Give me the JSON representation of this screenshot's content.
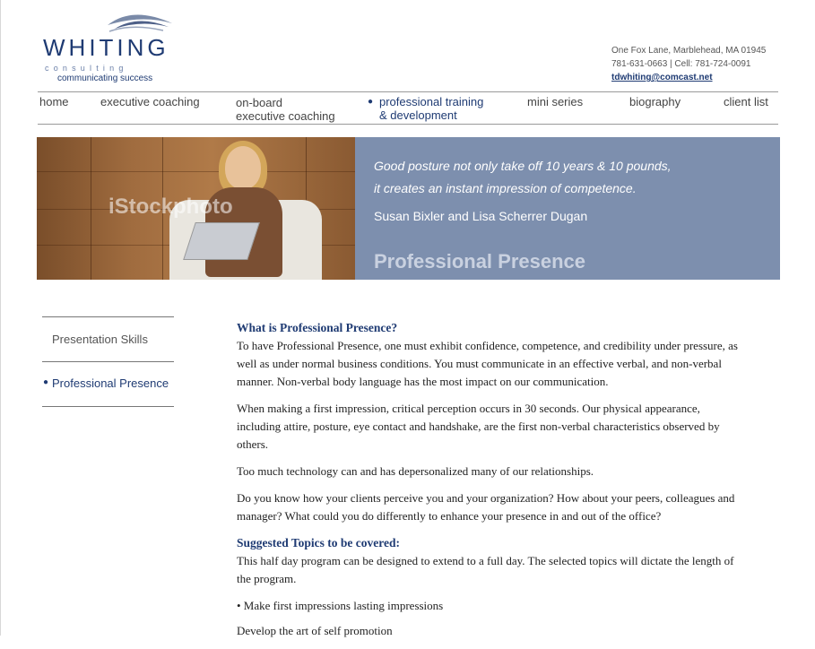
{
  "header": {
    "logo": {
      "brand": "WHITING",
      "sub1": "consulting",
      "tagline": "communicating success"
    },
    "contact": {
      "address": "One Fox Lane, Marblehead, MA 01945",
      "phones": "781-631-0663 | Cell: 781-724-0091",
      "email": "tdwhiting@comcast.net"
    }
  },
  "nav": {
    "home": "home",
    "executive_coaching": "executive coaching",
    "onboard_line1": "on-board",
    "onboard_line2": "executive coaching",
    "training_line1": "professional training",
    "training_line2": "& development",
    "mini_series": "mini series",
    "biography": "biography",
    "client_list": "client list"
  },
  "banner": {
    "watermark": "iStockphoto",
    "quote_line1": "Good posture not only take off 10 years & 10 pounds,",
    "quote_line2": "it creates an instant impression of competence.",
    "authors": "Susan Bixler and Lisa Scherrer Dugan",
    "title": "Professional Presence"
  },
  "sidebar": {
    "items": [
      {
        "label": "Presentation Skills"
      },
      {
        "label": "Professional Presence"
      }
    ]
  },
  "content": {
    "heading1": "What is Professional Presence?",
    "p1": "To have Professional Presence, one must exhibit confidence, competence, and credibility under pressure, as well as under normal business conditions. You must communicate in an effective verbal, and non-verbal manner. Non-verbal body language has the most impact on our communication.",
    "p2": "When making a first impression, critical perception occurs in 30 seconds. Our physical appearance, including attire, posture, eye contact and handshake, are the first non-verbal characteristics observed by others.",
    "p3": "Too much technology can and has depersonalized many of our relationships.",
    "p4": "Do you know how your clients perceive you and your organization? How about your peers, colleagues and manager? What could you do differently to enhance your presence in and out of the office?",
    "heading2": "Suggested Topics to be covered:",
    "p5": "This half day program can be designed to extend to a full day. The selected topics will dictate the length of the program.",
    "bullet1": "• Make first impressions lasting impressions",
    "bullet2": "Develop the art of self promotion"
  },
  "colors": {
    "brand_navy": "#1f3b73",
    "banner_blue": "#7d8fae"
  }
}
